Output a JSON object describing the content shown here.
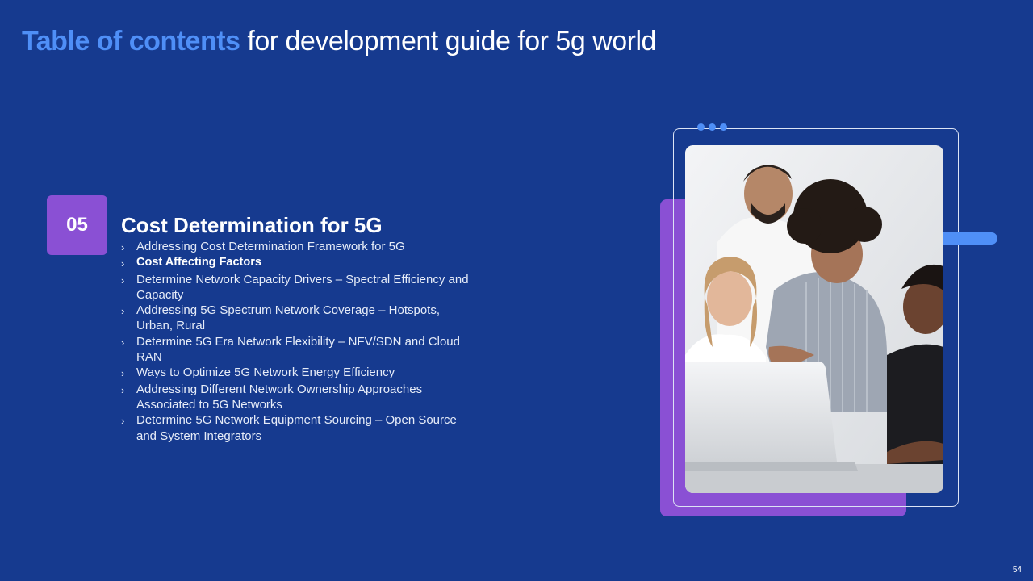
{
  "title": {
    "accent": "Table of contents",
    "rest": " for development guide for 5g world"
  },
  "section": {
    "number": "05",
    "heading": "Cost Determination for 5G"
  },
  "toc_items": [
    "Addressing Cost Determination Framework for 5G",
    "Cost Affecting Factors",
    "Determine Network Capacity Drivers – Spectral Efficiency and Capacity",
    "Addressing 5G Spectrum Network Coverage – Hotspots, Urban, Rural",
    "Determine 5G Era Network Flexibility  – NFV/SDN and Cloud RAN",
    "Ways to Optimize 5G Network Energy Efficiency",
    "Addressing Different Network Ownership Approaches Associated to 5G Networks",
    "Determine 5G Network Equipment Sourcing – Open Source and System Integrators"
  ],
  "active_item_index": 1,
  "bullet_glyph": "›",
  "photo_icon": "team-photo",
  "page_number": "54",
  "colors": {
    "background": "#163A8F",
    "accent_blue": "#4F8FF7",
    "accent_purple": "#8A50D4"
  }
}
